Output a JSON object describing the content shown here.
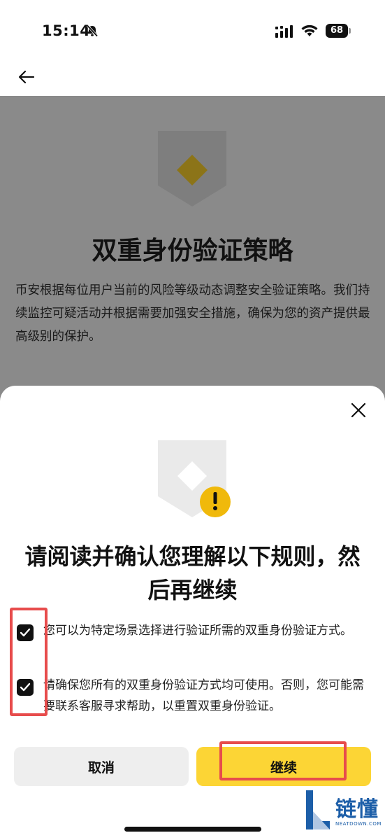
{
  "status_bar": {
    "time": "15:14",
    "battery": "68"
  },
  "background_page": {
    "title": "双重身份验证策略",
    "description": "币安根据每位用户当前的风险等级动态调整安全验证策略。我们持续监控可疑活动并根据需要加强安全措施，确保为您的资产提供最高级别的保护。"
  },
  "sheet": {
    "title": "请阅读并确认您理解以下规则，然后再继续",
    "rules": [
      {
        "text": "您可以为特定场景选择进行验证所需的双重身份验证方式。",
        "checked": true
      },
      {
        "text": "请确保您所有的双重身份验证方式均可使用。否则，您可能需要联系客服寻求帮助，以重置双重身份验证。",
        "checked": true
      }
    ],
    "cancel_label": "取消",
    "continue_label": "继续"
  },
  "watermark": {
    "name": "链懂",
    "site": "NEATDOWN.COM"
  },
  "colors": {
    "accent": "#fcd535",
    "warning": "#f0b90b",
    "highlight": "#e74c4c"
  }
}
